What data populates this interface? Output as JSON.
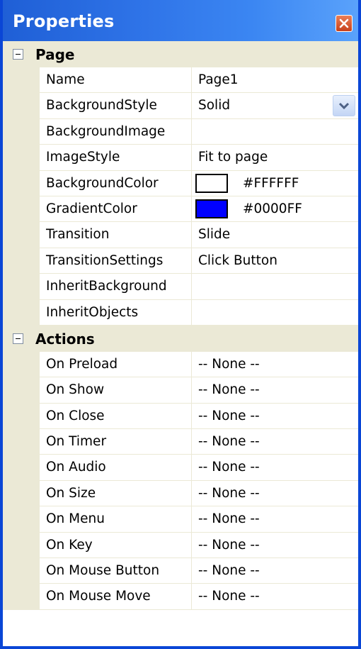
{
  "window": {
    "title": "Properties"
  },
  "icons": {
    "close": "close-icon",
    "toggle": "collapse-icon",
    "dropdown": "chevron-down-icon"
  },
  "colors": {
    "title_bar": "#2f74e8",
    "border": "#0a46d6",
    "gutter": "#ebe9d6",
    "close_button": "#d55a30"
  },
  "categories": {
    "page": {
      "label": "Page",
      "props": [
        {
          "name": "Name",
          "value": "Page1"
        },
        {
          "name": "BackgroundStyle",
          "value": "Solid"
        },
        {
          "name": "BackgroundImage",
          "value": ""
        },
        {
          "name": "ImageStyle",
          "value": "Fit to page"
        },
        {
          "name": "BackgroundColor",
          "value": "#FFFFFF",
          "swatch": "#FFFFFF"
        },
        {
          "name": "GradientColor",
          "value": "#0000FF",
          "swatch": "#0000FF"
        },
        {
          "name": "Transition",
          "value": "Slide"
        },
        {
          "name": "TransitionSettings",
          "value": "Click Button"
        },
        {
          "name": "InheritBackground",
          "value": ""
        },
        {
          "name": "InheritObjects",
          "value": ""
        }
      ]
    },
    "actions": {
      "label": "Actions",
      "props": [
        {
          "name": "On Preload",
          "value": "-- None --"
        },
        {
          "name": "On Show",
          "value": "-- None --"
        },
        {
          "name": "On Close",
          "value": "-- None --"
        },
        {
          "name": "On Timer",
          "value": "-- None --"
        },
        {
          "name": "On Audio",
          "value": "-- None --"
        },
        {
          "name": "On Size",
          "value": "-- None --"
        },
        {
          "name": "On Menu",
          "value": "-- None --"
        },
        {
          "name": "On Key",
          "value": "-- None --"
        },
        {
          "name": "On Mouse Button",
          "value": "-- None --"
        },
        {
          "name": "On Mouse Move",
          "value": "-- None --"
        }
      ]
    }
  }
}
